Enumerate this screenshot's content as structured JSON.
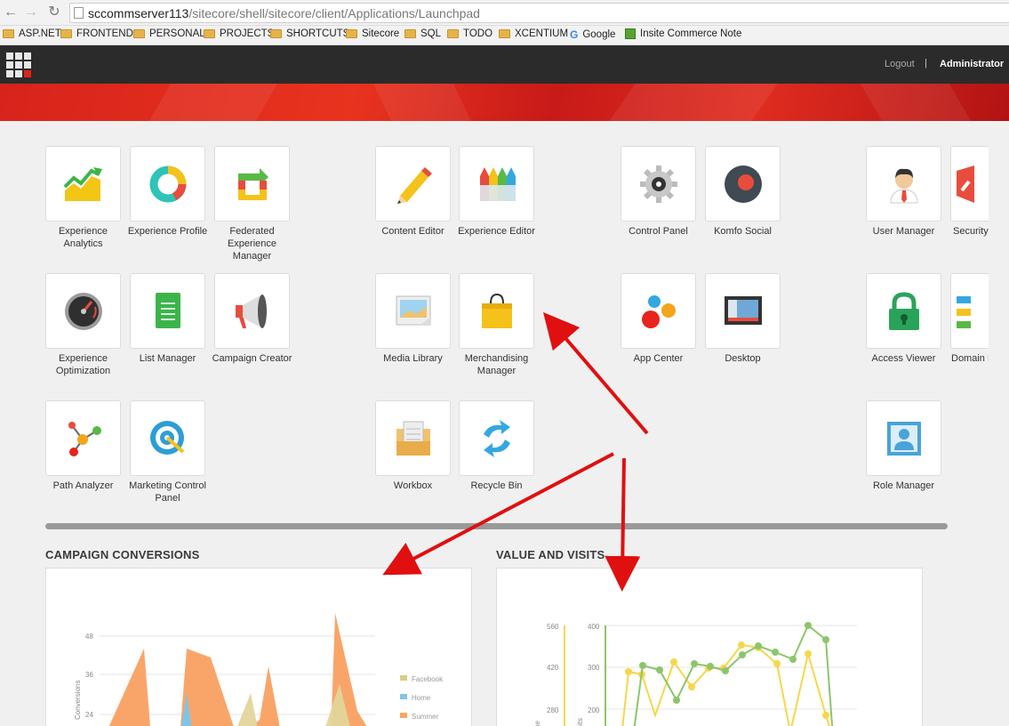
{
  "browser": {
    "url_host": "sccommserver113",
    "url_path": "/sitecore/shell/sitecore/client/Applications/Launchpad",
    "bookmarks": [
      "ASP.NET",
      "FRONTEND",
      "PERSONAL",
      "PROJECTS",
      "SHORTCUTS",
      "Sitecore",
      "SQL",
      "TODO",
      "XCENTIUM",
      "Google",
      "Insite Commerce Note"
    ]
  },
  "topbar": {
    "logout_label": "Logout",
    "separator": "|",
    "user_label": "Administrator"
  },
  "tiles": [
    {
      "label": "Experience Analytics",
      "icon": "analytics-icon"
    },
    {
      "label": "Experience Profile",
      "icon": "profile-ring-icon"
    },
    {
      "label": "Federated Experience Manager",
      "icon": "federated-icon"
    },
    {
      "label": "Content Editor",
      "icon": "pencil-icon"
    },
    {
      "label": "Experience Editor",
      "icon": "crayons-icon"
    },
    {
      "label": "Control Panel",
      "icon": "gear-icon"
    },
    {
      "label": "Komfo Social",
      "icon": "komfo-icon"
    },
    {
      "label": "User Manager",
      "icon": "user-icon"
    },
    {
      "label": "Security",
      "icon": "security-icon"
    },
    {
      "label": "Experience Optimization",
      "icon": "gauge-icon"
    },
    {
      "label": "List Manager",
      "icon": "list-icon"
    },
    {
      "label": "Campaign Creator",
      "icon": "megaphone-icon"
    },
    {
      "label": "Media Library",
      "icon": "media-icon"
    },
    {
      "label": "Merchandising Manager",
      "icon": "bag-icon"
    },
    {
      "label": "App Center",
      "icon": "dots-icon"
    },
    {
      "label": "Desktop",
      "icon": "desktop-icon"
    },
    {
      "label": "Access Viewer",
      "icon": "lock-icon"
    },
    {
      "label": "Domain M",
      "icon": "domain-icon"
    },
    {
      "label": "Path Analyzer",
      "icon": "path-icon"
    },
    {
      "label": "Marketing Control Panel",
      "icon": "target-icon"
    },
    {
      "label": "Workbox",
      "icon": "workbox-icon"
    },
    {
      "label": "Recycle Bin",
      "icon": "recycle-icon"
    },
    {
      "label": "Role Manager",
      "icon": "role-icon"
    }
  ],
  "campaign": {
    "title": "CAMPAIGN CONVERSIONS",
    "ylabel": "Conversions",
    "ticks": [
      "48",
      "36",
      "24"
    ],
    "legend": [
      "Facebook",
      "Home",
      "Summer"
    ]
  },
  "valuevisits": {
    "title": "VALUE AND VISITS",
    "left_ticks": [
      "560",
      "420",
      "280"
    ],
    "right_ticks": [
      "400",
      "300",
      "200"
    ],
    "left_label": "ue",
    "right_label": "sits"
  },
  "colors": {
    "accent_red": "#e2231a",
    "topbar": "#2b2b2b",
    "orange_area": "#f9a56a",
    "green_line": "#8dc56b",
    "yellow_line": "#f6d74a",
    "annotation_red": "#e01010"
  }
}
